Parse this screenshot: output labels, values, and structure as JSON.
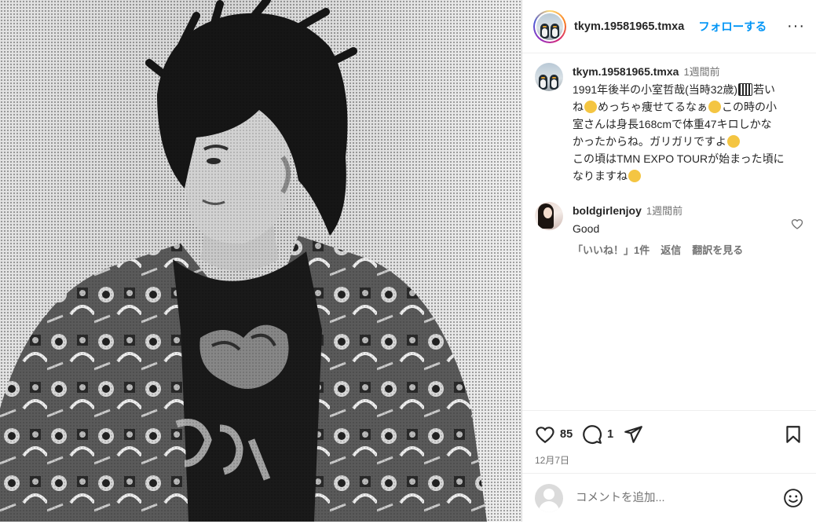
{
  "post": {
    "author": "tkym.19581965.tmxa",
    "follow_label": "フォローする",
    "more_label": "···",
    "caption": {
      "username": "tkym.19581965.tmxa",
      "time": "1週間前",
      "lines": [
        "1991年後半の小室哲哉(当時32歳)",
        "若い",
        "ね",
        "めっちゃ痩せてるなぁ",
        "この時の小",
        "室さんは身長168cmで体重47キロしかな",
        "かったからね。ガリガリですよ",
        "この頃はTMN EXPO TOURが始まった頃に",
        "なりますね"
      ]
    },
    "comments": [
      {
        "username": "boldgirlenjoy",
        "time": "1週間前",
        "text": "Good",
        "likes_label": "「いいね！」1件",
        "reply_label": "返信",
        "translate_label": "翻訳を見る"
      }
    ],
    "like_count": "85",
    "comment_count": "1",
    "date": "12月7日",
    "add_comment_placeholder": "コメントを追加..."
  },
  "icons": {
    "like": "heart-icon",
    "comment": "comment-icon",
    "share": "share-icon",
    "save": "bookmark-icon",
    "emoji": "smiley-icon"
  },
  "colors": {
    "link": "#0095f6",
    "muted": "#737373",
    "text": "#262626"
  }
}
